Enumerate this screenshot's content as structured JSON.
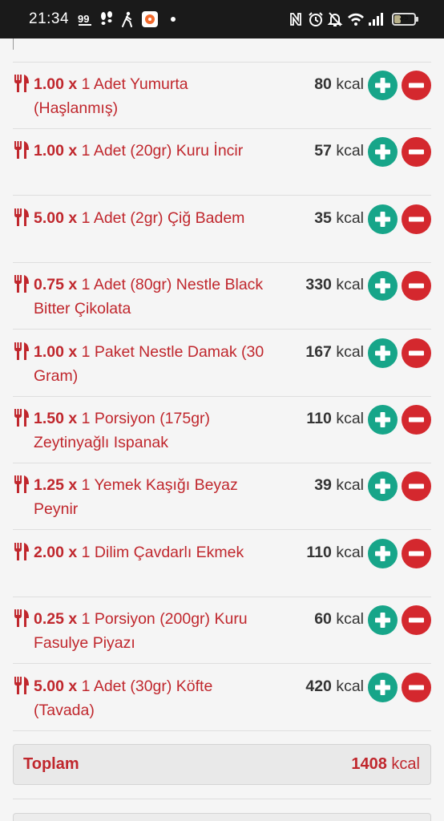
{
  "status_bar": {
    "time": "21:34",
    "battery": "35",
    "left_icons": [
      "quote-badge-icon",
      "footsteps-icon",
      "walking-icon",
      "app-flower-icon",
      "dot-icon"
    ],
    "right_icons": [
      "nfc-icon",
      "alarm-icon",
      "mute-icon",
      "wifi-icon",
      "signal-icon",
      "battery-icon"
    ]
  },
  "colors": {
    "accent_red": "#c0272d",
    "plus_green": "#17a589",
    "minus_red": "#d4282e"
  },
  "unit": "kcal",
  "foods": [
    {
      "qty": "1.00 x",
      "name": "1 Adet Yumurta (Haşlanmış)",
      "kcal": "80"
    },
    {
      "qty": "1.00 x",
      "name": "1 Adet (20gr) Kuru İncir",
      "kcal": "57"
    },
    {
      "qty": "5.00 x",
      "name": "1 Adet (2gr) Çiğ Badem",
      "kcal": "35"
    },
    {
      "qty": "0.75 x",
      "name": "1 Adet (80gr) Nestle Black Bitter Çikolata",
      "kcal": "330"
    },
    {
      "qty": "1.00 x",
      "name": "1 Paket Nestle Damak (30 Gram)",
      "kcal": "167"
    },
    {
      "qty": "1.50 x",
      "name": "1 Porsiyon (175gr) Zeytinyağlı Ispanak",
      "kcal": "110"
    },
    {
      "qty": "1.25 x",
      "name": "1 Yemek Kaşığı Beyaz Peynir",
      "kcal": "39"
    },
    {
      "qty": "2.00 x",
      "name": "1 Dilim Çavdarlı Ekmek",
      "kcal": "110"
    },
    {
      "qty": "0.25 x",
      "name": "1 Porsiyon (200gr) Kuru Fasulye Piyazı",
      "kcal": "60"
    },
    {
      "qty": "5.00 x",
      "name": "1 Adet (30gr) Köfte (Tavada)",
      "kcal": "420"
    }
  ],
  "total": {
    "label": "Toplam",
    "value": "1408"
  }
}
